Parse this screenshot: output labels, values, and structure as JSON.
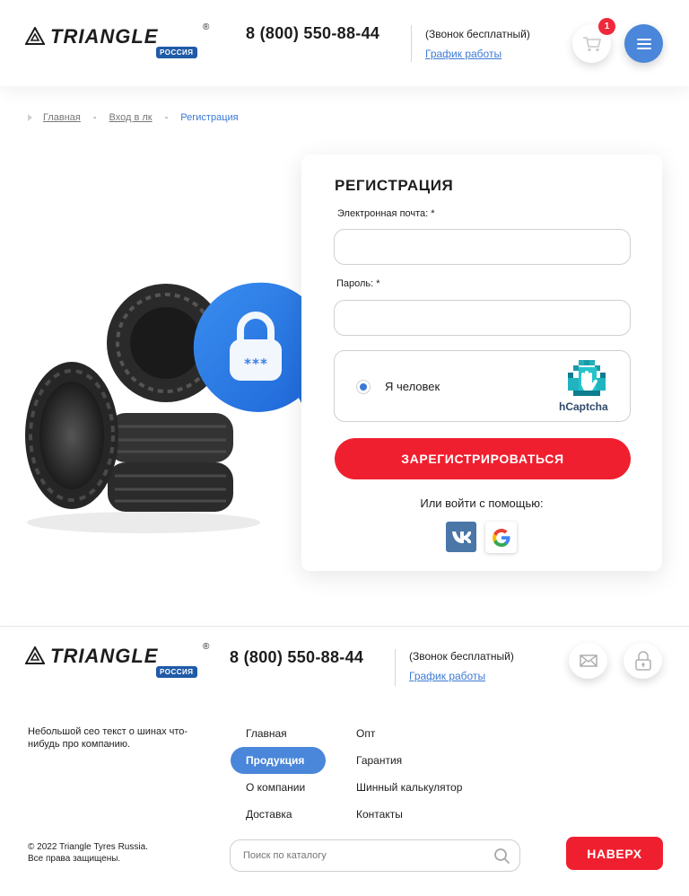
{
  "header": {
    "logo_text": "TRIANGLE",
    "logo_registered": "®",
    "logo_badge": "РОССИЯ",
    "phone": "8 (800) 550-88-44",
    "free_call": "(Звонок бесплатный)",
    "schedule_link": "График работы",
    "cart_count": "1",
    "icons": {
      "cart": "cart-icon",
      "menu": "hamburger-menu-icon"
    }
  },
  "breadcrumb": {
    "items": [
      "Главная",
      "Вход в лк",
      "Регистрация"
    ],
    "separator": "-"
  },
  "form": {
    "title": "РЕГИСТРАЦИЯ",
    "email_label": "Электронная почта: *",
    "email_value": "",
    "password_label": "Пароль: *",
    "password_value": "",
    "captcha_label": "Я человек",
    "captcha_brand": "hCaptcha",
    "submit_label": "ЗАРЕГИСТРИРОВАТЬСЯ",
    "social_title": "Или войти с помощью:",
    "social": [
      "vk",
      "google"
    ]
  },
  "footer": {
    "logo_text": "TRIANGLE",
    "logo_badge": "РОССИЯ",
    "phone": "8 (800) 550-88-44",
    "free_call": "(Звонок бесплатный)",
    "schedule_link": "График работы",
    "seo_text": "Небольшой сео текст о шинах что-нибудь про компанию.",
    "nav_col1": [
      "Главная",
      "Продукция",
      "О компании",
      "Доставка"
    ],
    "nav_col2": [
      "Опт",
      "Гарантия",
      "Шинный калькулятор",
      "Контакты"
    ],
    "active_nav": "Продукция",
    "copyright": "© 2022 Triangle Tyres Russia.",
    "rights": "Все права защищены.",
    "search_placeholder": "Поиск по каталогу",
    "top_button": "НАВЕРХ",
    "icons": {
      "mail": "mail-icon",
      "lock": "lock-icon",
      "search": "search-icon"
    }
  },
  "colors": {
    "accent_blue": "#4a86d9",
    "link_blue": "#3c7ad6",
    "red": "#f01f2f",
    "vk": "#4a76a8"
  }
}
